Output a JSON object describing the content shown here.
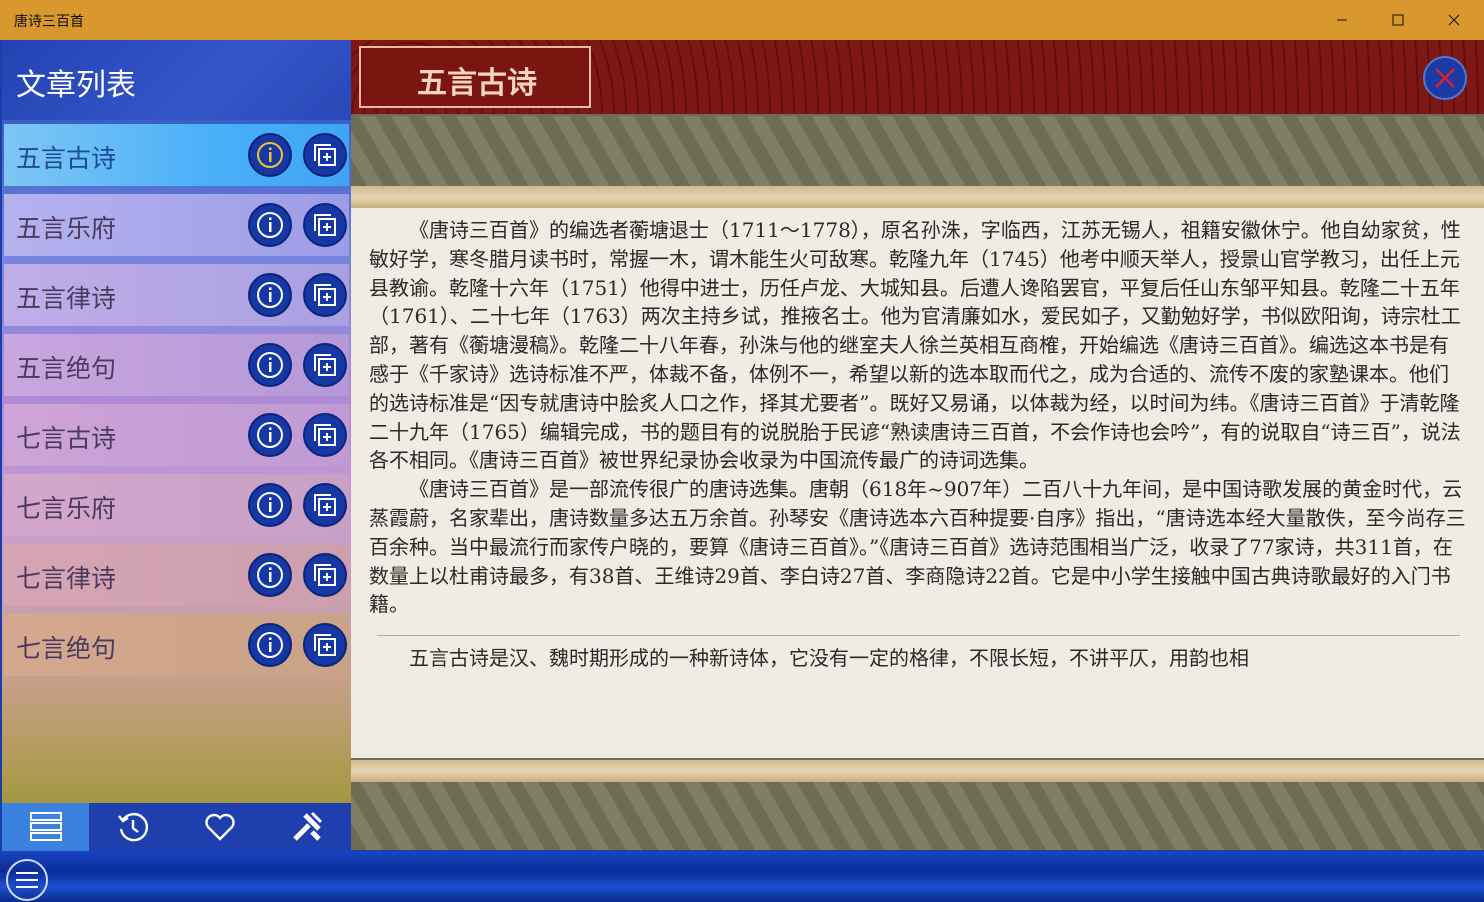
{
  "window": {
    "title": "唐诗三百首"
  },
  "sidebar": {
    "title": "文章列表",
    "items": [
      {
        "label": "五言古诗"
      },
      {
        "label": "五言乐府"
      },
      {
        "label": "五言律诗"
      },
      {
        "label": "五言绝句"
      },
      {
        "label": "七言古诗"
      },
      {
        "label": "七言乐府"
      },
      {
        "label": "七言律诗"
      },
      {
        "label": "七言绝句"
      }
    ],
    "selected_index": 0
  },
  "content": {
    "heading": "五言古诗",
    "paragraphs": [
      "《唐诗三百首》的编选者蘅塘退士（1711～1778），原名孙洙，字临西，江苏无锡人，祖籍安徽休宁。他自幼家贫，性敏好学，寒冬腊月读书时，常握一木，谓木能生火可敌寒。乾隆九年（1745）他考中顺天举人，授景山官学教习，出任上元县教谕。乾隆十六年（1751）他得中进士，历任卢龙、大城知县。后遭人谗陷罢官，平复后任山东邹平知县。乾隆二十五年（1761）、二十七年（1763）两次主持乡试，推掖名士。他为官清廉如水，爱民如子，又勤勉好学，书似欧阳询，诗宗杜工部，著有《蘅塘漫稿》。乾隆二十八年春，孙洙与他的继室夫人徐兰英相互商榷，开始编选《唐诗三百首》。编选这本书是有感于《千家诗》选诗标准不严，体裁不备，体例不一，希望以新的选本取而代之，成为合适的、流传不废的家塾课本。他们的选诗标准是“因专就唐诗中脍炙人口之作，择其尤要者”。既好又易诵，以体裁为经，以时间为纬。《唐诗三百首》于清乾隆二十九年（1765）编辑完成，书的题目有的说脱胎于民谚“熟读唐诗三百首，不会作诗也会吟”，有的说取自“诗三百”，说法各不相同。《唐诗三百首》被世界纪录协会收录为中国流传最广的诗词选集。",
      "《唐诗三百首》是一部流传很广的唐诗选集。唐朝（618年~907年）二百八十九年间，是中国诗歌发展的黄金时代，云蒸霞蔚，名家辈出，唐诗数量多达五万余首。孙琴安《唐诗选本六百种提要·自序》指出，“唐诗选本经大量散佚，至今尚存三百余种。当中最流行而家传户晓的，要算《唐诗三百首》。”《唐诗三百首》选诗范围相当广泛，收录了77家诗，共311首，在数量上以杜甫诗最多，有38首、王维诗29首、李白诗27首、李商隐诗22首。它是中小学生接触中国古典诗歌最好的入门书籍。",
      "五言古诗是汉、魏时期形成的一种新诗体，它没有一定的格律，不限长短，不讲平仄，用韵也相"
    ]
  },
  "colors": {
    "titlebar": "#d8982d",
    "banner": "#6e1410",
    "accent": "#1638a4"
  },
  "bottom_nav": [
    {
      "icon": "list-icon",
      "selected": true
    },
    {
      "icon": "history-icon"
    },
    {
      "icon": "heart-icon"
    },
    {
      "icon": "tools-icon"
    }
  ]
}
